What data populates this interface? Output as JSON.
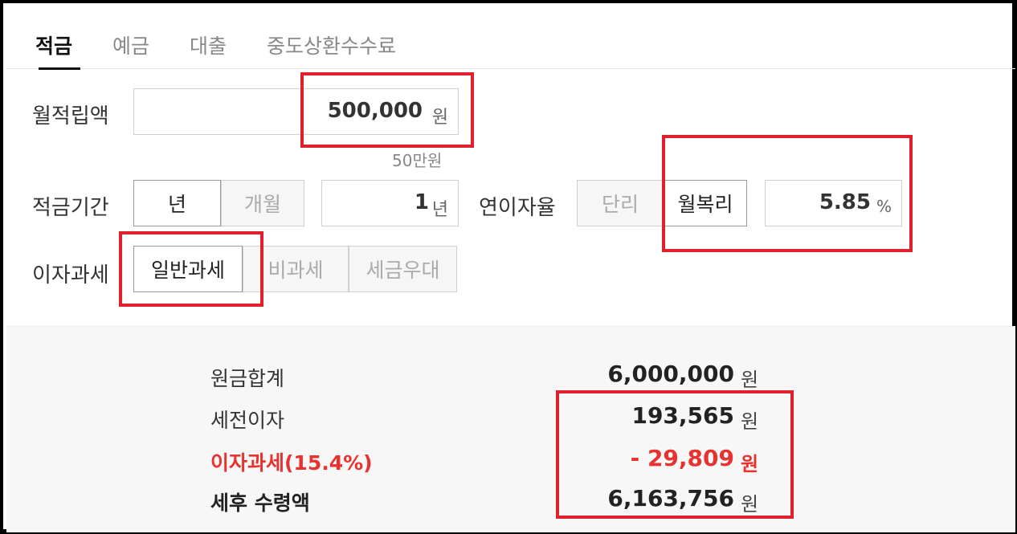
{
  "tabs": [
    "적금",
    "예금",
    "대출",
    "중도상환수수료"
  ],
  "monthly": {
    "label": "월적립액",
    "value": "500,000",
    "unit": "원",
    "hint": "50만원"
  },
  "period": {
    "label": "적금기간",
    "options": [
      "년",
      "개월"
    ],
    "selected": "년",
    "value": "1",
    "unit": "년"
  },
  "rate": {
    "label": "연이자율",
    "options": [
      "단리",
      "월복리"
    ],
    "selected": "월복리",
    "value": "5.85",
    "unit": "%"
  },
  "tax": {
    "label": "이자과세",
    "options": [
      "일반과세",
      "비과세",
      "세금우대"
    ],
    "selected": "일반과세"
  },
  "results": [
    {
      "label": "원금합계",
      "value": "6,000,000",
      "unit": "원"
    },
    {
      "label": "세전이자",
      "value": "193,565",
      "unit": "원"
    },
    {
      "label": "이자과세(15.4%)",
      "value": "- 29,809",
      "unit": "원"
    },
    {
      "label": "세후 수령액",
      "value": "6,163,756",
      "unit": "원"
    }
  ],
  "colors": {
    "highlight": "#e0202a",
    "negative": "#e8322f"
  }
}
